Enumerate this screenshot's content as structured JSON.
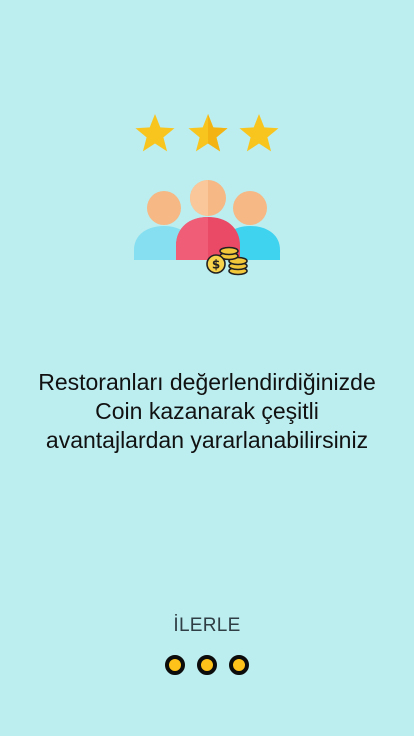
{
  "onboarding": {
    "message_lines": [
      "Restoranları değerlendirdiğinizde",
      "Coin kazanarak çeşitli",
      "avantajlardan yararlanabilirsiniz"
    ],
    "next_label": "İLERLE",
    "page_count": 3,
    "illustration": {
      "icon": "rating-users-coins-icon",
      "stars": 3
    }
  },
  "colors": {
    "background": "#bcedef",
    "star": "#ffc21a",
    "dot_fill": "#ffc21a"
  }
}
